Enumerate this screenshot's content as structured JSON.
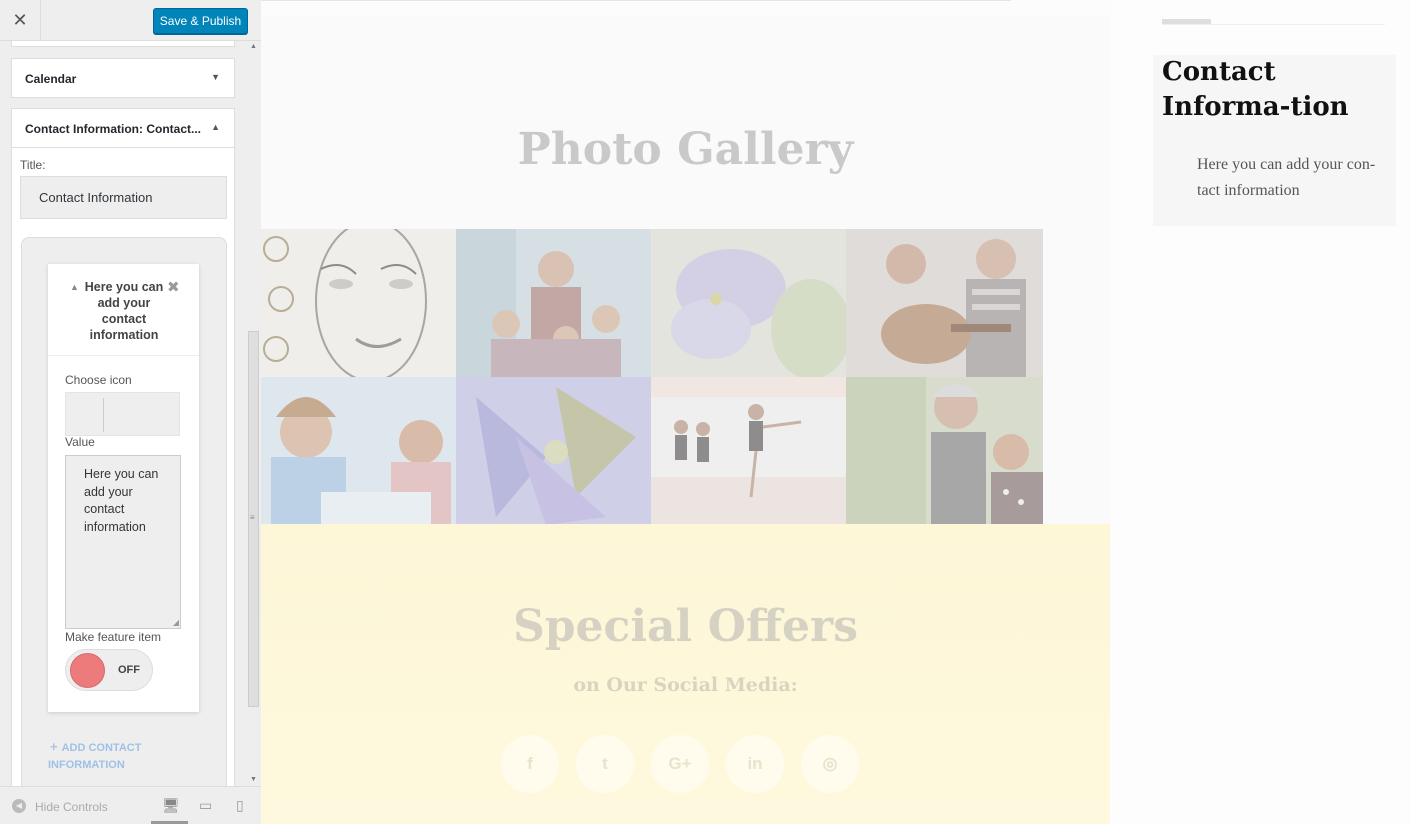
{
  "topbar": {
    "close_icon": "close-icon",
    "close_glyph": "✕",
    "save_label": "Save & Publish"
  },
  "sections": {
    "calendar_title": "Calendar",
    "contact_title": "Contact Information: Contact..."
  },
  "widget": {
    "title_label": "Title:",
    "title_value": "Contact Information",
    "item": {
      "heading": "Here you can add your contact information",
      "choose_icon_label": "Choose icon",
      "value_label": "Value",
      "value_text": "Here you can add your contact information",
      "feature_label": "Make feature item",
      "toggle_state": "OFF"
    },
    "add_button": "ADD CONTACT INFORMATION"
  },
  "footer": {
    "hide_controls": "Hide Controls"
  },
  "preview": {
    "gallery_title": "Photo Gallery",
    "offers_title": "Special Offers",
    "offers_subtitle": "on Our Social Media:",
    "social_icons": [
      "facebook-icon",
      "twitter-icon",
      "google-plus-icon",
      "linkedin-icon",
      "instagram-icon"
    ],
    "social_glyphs": [
      "f",
      "t",
      "G+",
      "in",
      "◎"
    ],
    "contact_widget_title": "Contact Informa-tion",
    "contact_widget_text": "Here you can add your con-tact information"
  },
  "colors": {
    "primary_button": "#0085ba",
    "toggle_off": "#ee7b7b",
    "offers_background": "#fdf6d7"
  }
}
